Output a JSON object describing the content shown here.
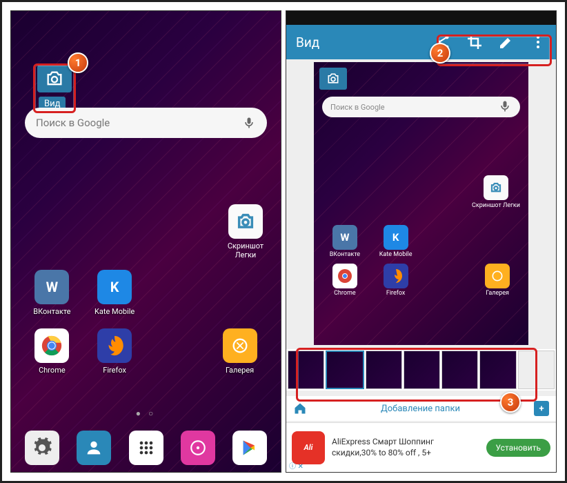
{
  "callouts": {
    "one": "1",
    "two": "2",
    "three": "3"
  },
  "left": {
    "overlay_label": "Вид",
    "search_placeholder": "Поиск в Google",
    "solo_app": "Скриншот Легки",
    "apps": {
      "vk": "ВКонтакте",
      "kate": "Kate Mobile",
      "chrome": "Chrome",
      "firefox": "Firefox",
      "gallery": "Галерея"
    }
  },
  "right": {
    "title": "Вид",
    "search_placeholder": "Поиск в Google",
    "solo_app": "Скриншот Легки",
    "apps": {
      "vk": "ВКонтакте",
      "kate": "Kate Mobile",
      "chrome": "Chrome",
      "firefox": "Firefox",
      "gallery": "Галерея"
    },
    "folder_label": "Добавление папки",
    "ad_title": "AliExpress Смарт Шоппинг",
    "ad_sub": "скидки,30% to 80% off , 5+",
    "ad_btn": "Установить",
    "ad_logo": "Ali"
  }
}
